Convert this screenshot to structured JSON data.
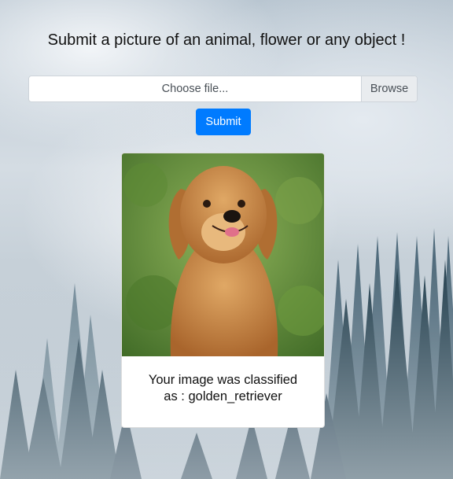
{
  "page": {
    "heading": "Submit a picture of an animal, flower or any object !"
  },
  "upload": {
    "file_placeholder": "Choose file...",
    "browse_label": "Browse",
    "submit_label": "Submit"
  },
  "result": {
    "line1": "Your image was classified",
    "line2": "as : golden_retriever"
  },
  "colors": {
    "primary": "#007bff",
    "forest_dark": "#1f3a4c",
    "grass": "#6c9a3e",
    "dog_fur": "#c9833f"
  },
  "icons": {
    "background": "misty-forest-background",
    "result_image": "golden-retriever-photo"
  }
}
